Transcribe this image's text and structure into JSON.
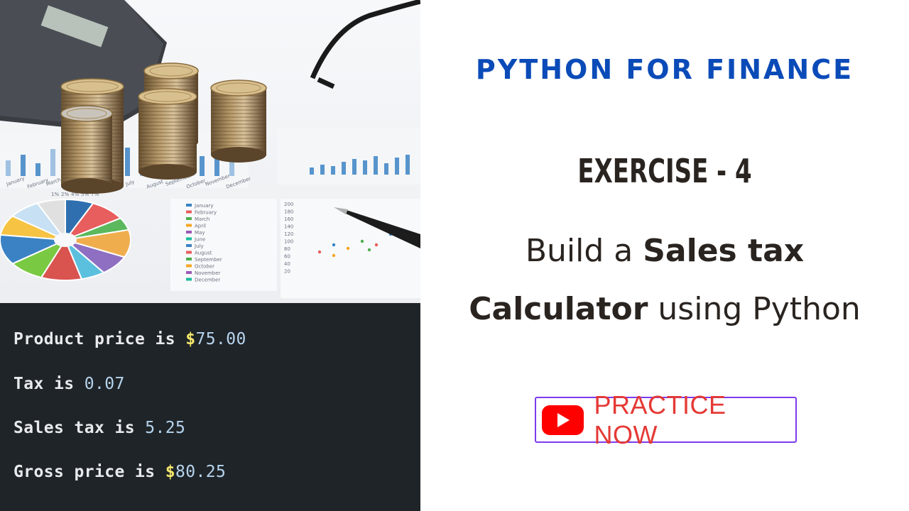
{
  "title": "PYTHON FOR FINANCE",
  "exercise": "EXERCISE - 4",
  "headline": {
    "line1_prefix": "Build a ",
    "line1_bold": "Sales tax",
    "line2_bold": "Calculator",
    "line2_suffix": " using Python"
  },
  "practice_button": {
    "label": "PRACTICE NOW",
    "icon": "youtube-play-icon",
    "text_color": "#e53935",
    "border_color": "#7c3aed"
  },
  "console": {
    "background": "#1f2428",
    "lines": [
      {
        "prefix": "Product price is ",
        "dollar": "$",
        "value": "75.00"
      },
      {
        "prefix": "Tax is ",
        "dollar": "",
        "value": "0.07"
      },
      {
        "prefix": "Sales tax is ",
        "dollar": "",
        "value": "5.25"
      },
      {
        "prefix": "Gross price is ",
        "dollar": "$",
        "value": "80.25"
      }
    ]
  },
  "photo": {
    "description_icons": [
      "calculator-icon",
      "coin-stack-icon",
      "pie-chart-icon",
      "pen-icon",
      "glasses-icon"
    ],
    "month_labels": [
      "January",
      "February",
      "March",
      "April",
      "May",
      "June",
      "July",
      "August",
      "September",
      "October",
      "November",
      "December"
    ],
    "pie_labels": [
      "1%",
      "2%",
      "4%",
      "5%",
      "7%"
    ],
    "axis_labels": [
      "200",
      "180",
      "160",
      "140",
      "120",
      "100",
      "80",
      "60",
      "40",
      "20"
    ],
    "accent_color": "#3b82c4"
  },
  "colors": {
    "title_blue": "#0b4bb8",
    "dark_text": "#2a2420",
    "dollar_yellow": "#f5e86b",
    "number_blue": "#b6d4ee"
  }
}
